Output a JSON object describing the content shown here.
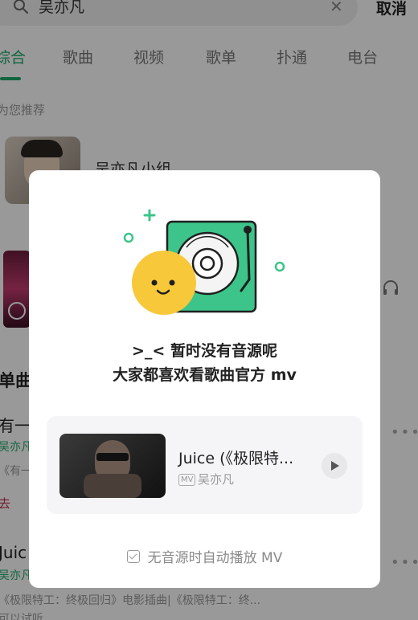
{
  "search": {
    "query": "吴亦凡",
    "cancel_label": "取消"
  },
  "tabs": [
    {
      "label": "综合"
    },
    {
      "label": "歌曲"
    },
    {
      "label": "视频"
    },
    {
      "label": "歌单"
    },
    {
      "label": "扑通"
    },
    {
      "label": "电台"
    }
  ],
  "recommend": {
    "label": "为您推荐",
    "group_name": "吴亦凡小组"
  },
  "songs": {
    "section_label": "单曲",
    "row1": {
      "title": "有一",
      "artist": "吴亦凡",
      "album": "《有一",
      "tag": "去"
    },
    "row2": {
      "title": "Juic",
      "artist": "吴亦凡",
      "album": "《极限特工：终极回归》电影插曲|《极限特工：终...",
      "extra": "可以试听"
    }
  },
  "dialog": {
    "message_line1": ">_< 暂时没有音源呢",
    "message_line2": "大家都喜欢看歌曲官方 mv",
    "mv": {
      "title": "Juice (《极限特...",
      "badge": "MV",
      "artist": "吴亦凡"
    },
    "auto_play_label": "无音源时自动播放 MV",
    "auto_play_checked": true
  },
  "colors": {
    "accent": "#1fa86a",
    "illustration_green": "#3cc48a",
    "face_yellow": "#f7c83a"
  }
}
